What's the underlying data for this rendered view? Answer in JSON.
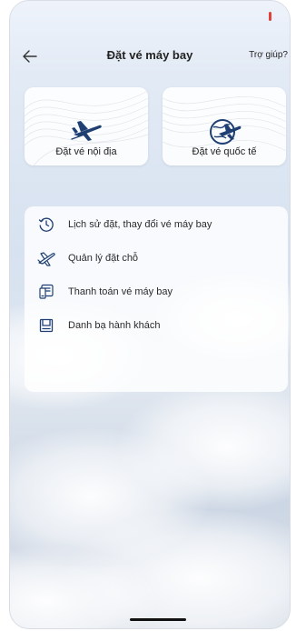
{
  "header": {
    "title": "Đặt vé máy bay",
    "help_label": "Trợ giúp?"
  },
  "cards": [
    {
      "label": "Đặt vé nội địa",
      "icon": "airplane-icon"
    },
    {
      "label": "Đặt vé quốc tế",
      "icon": "globe-airplane-icon"
    }
  ],
  "menu": {
    "items": [
      {
        "label": "Lịch sử đặt, thay đổi vé máy bay",
        "icon": "history-clock-icon"
      },
      {
        "label": "Quản lý đặt chỗ",
        "icon": "flight-management-icon"
      },
      {
        "label": "Thanh toán vé máy bay",
        "icon": "payment-icon"
      },
      {
        "label": "Danh bạ hành khách",
        "icon": "contacts-book-icon"
      }
    ]
  },
  "colors": {
    "accent": "#1f3f73",
    "status_indicator": "#e0423a"
  }
}
